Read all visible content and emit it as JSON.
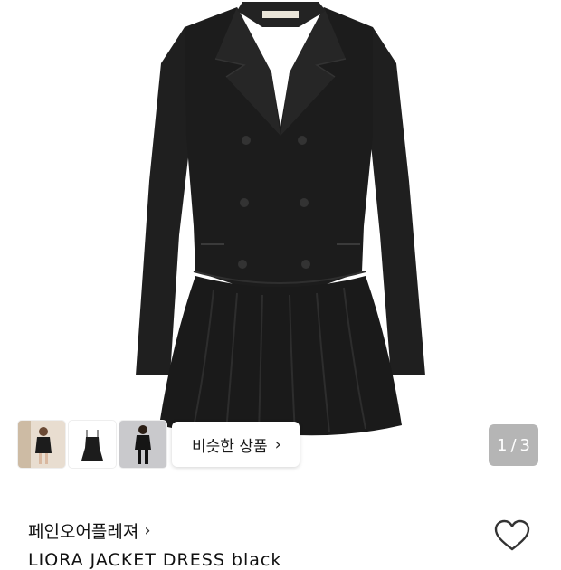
{
  "product": {
    "image_counter": {
      "current": "1",
      "separator": "/",
      "total": "3"
    },
    "thumbnails": [
      {
        "name": "thumbnail-model-front"
      },
      {
        "name": "thumbnail-slip-dress"
      },
      {
        "name": "thumbnail-model-studio"
      }
    ],
    "similar_button_label": "비슷한 상품",
    "similar_chevron": "›",
    "brand": "페인오어플레져",
    "brand_chevron": "›",
    "title": "LIORA JACKET DRESS black"
  },
  "colors": {
    "dress": "#1c1c1c",
    "counter_bg": "#787878",
    "heart_stroke": "#333333"
  },
  "icons": {
    "wishlist": "heart-outline-icon",
    "chevron": "chevron-right-icon"
  }
}
